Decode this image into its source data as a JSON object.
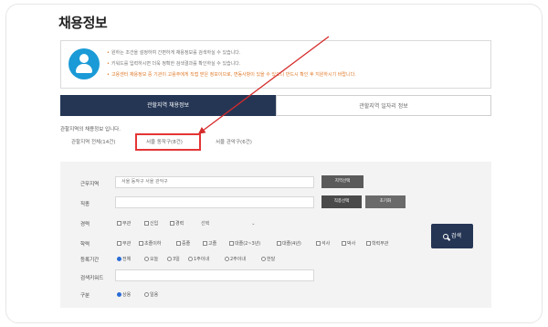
{
  "page": {
    "title": "채용정보"
  },
  "info": {
    "lines": [
      "원하는 조건을 설정하여 간편하게 채용정보를 검색하실 수 있습니다.",
      "키워드를 입력하시면 더욱 정확한 검색결과를 확인하실 수 있습니다.",
      "고용센터 채용정보 중 기관이 고용주에게 직접 받은 정보이므로, 변동사항이 있을 수 있으니 반드시 확인 후 지원하시기 바랍니다."
    ]
  },
  "tabs": {
    "active": "관할지역 채용정보",
    "inactive": "관할지역 일자리 정보"
  },
  "region": {
    "title": "관할지역의 채용정보 입니다.",
    "links": [
      "관할지역 전체(14건)",
      "서울 동작구(8건)",
      "서울 관악구(6건)"
    ]
  },
  "form": {
    "location_label": "근무지역",
    "location_value": "서울 동작구 서울 관악구",
    "location_button": "지역선택",
    "job_label": "직종",
    "job_button_1": "직종선택",
    "job_button_2": "초기화",
    "career_label": "경력",
    "career_options": [
      "무관",
      "신입",
      "경력"
    ],
    "career_select": "선택",
    "education_label": "학력",
    "education_options": [
      "무관",
      "초졸이하",
      "중졸",
      "고졸",
      "대졸(2~3년)",
      "대졸(4년)",
      "석사",
      "박사",
      "학력무관"
    ],
    "period_label": "등록기간",
    "period_options": [
      "전체",
      "오늘",
      "3일",
      "1주이내",
      "2주이내",
      "한달"
    ],
    "keyword_label": "검색키워드",
    "type_label": "구분",
    "type_options": [
      "상용",
      "일용"
    ],
    "search_button": "검색"
  },
  "colors": {
    "navy": "#253655",
    "accent_blue": "#1a9ad6",
    "highlight_red": "#e53535",
    "arrow_red": "#d62b2b"
  }
}
